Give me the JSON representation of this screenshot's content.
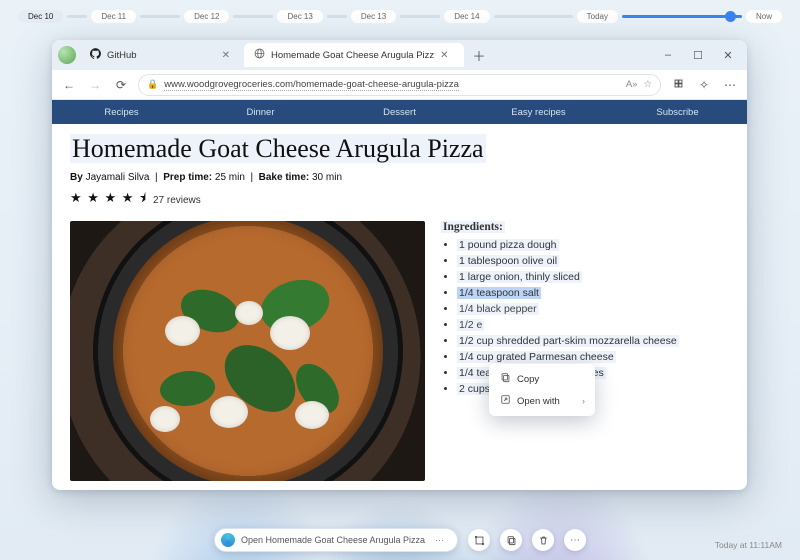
{
  "timeline": {
    "dates": [
      "Dec 10",
      "Dec 11",
      "Dec 12",
      "Dec 13",
      "Dec 13",
      "Dec 14"
    ],
    "today_label": "Today",
    "now_label": "Now"
  },
  "browser": {
    "tabs": [
      {
        "favicon": "github-icon",
        "label": "GitHub"
      },
      {
        "favicon": "globe-icon",
        "label": "Homemade Goat Cheese Arugula Pizz"
      }
    ],
    "active_tab_index": 1,
    "window_buttons": {
      "min": "–",
      "max": "☐",
      "close": "✕"
    },
    "toolbar": {
      "back": "←",
      "forward": "→",
      "reload": "⟳",
      "url": "www.woodgrovegroceries.com/homemade-goat-cheese-arugula-pizza"
    },
    "page_nav": [
      "Recipes",
      "Dinner",
      "Dessert",
      "Easy recipes",
      "Subscribe"
    ],
    "article": {
      "title": "Homemade Goat Cheese Arugula Pizza",
      "by_label": "By",
      "author": "Jayamali Silva",
      "prep_label": "Prep time:",
      "prep_value": "25 min",
      "bake_label": "Bake time:",
      "bake_value": "30 min",
      "rating_stars": 4.5,
      "reviews_count": "27 reviews"
    },
    "ingredients": {
      "heading": "Ingredients:",
      "items": [
        "1 pound pizza dough",
        "1 tablespoon olive oil",
        "1 large onion, thinly sliced",
        "1/4 teaspoon salt",
        "1/4                              black pepper",
        "1/2                              e",
        "1/2 cup shredded part-skim mozzarella cheese",
        "1/4 cup grated Parmesan cheese",
        "1/4 teaspoon red pepper flakes",
        "2 cups baby arugula"
      ],
      "selected_index": 3,
      "truncated_indices": [
        4,
        5
      ]
    },
    "context_menu": {
      "items": [
        {
          "icon": "copy-icon",
          "label": "Copy"
        },
        {
          "icon": "open-icon",
          "label": "Open with",
          "submenu": true
        }
      ]
    }
  },
  "bottombar": {
    "main_label": "Open Homemade Goat Cheese Arugula Pizza",
    "timestamp": "Today at 11:11AM"
  }
}
